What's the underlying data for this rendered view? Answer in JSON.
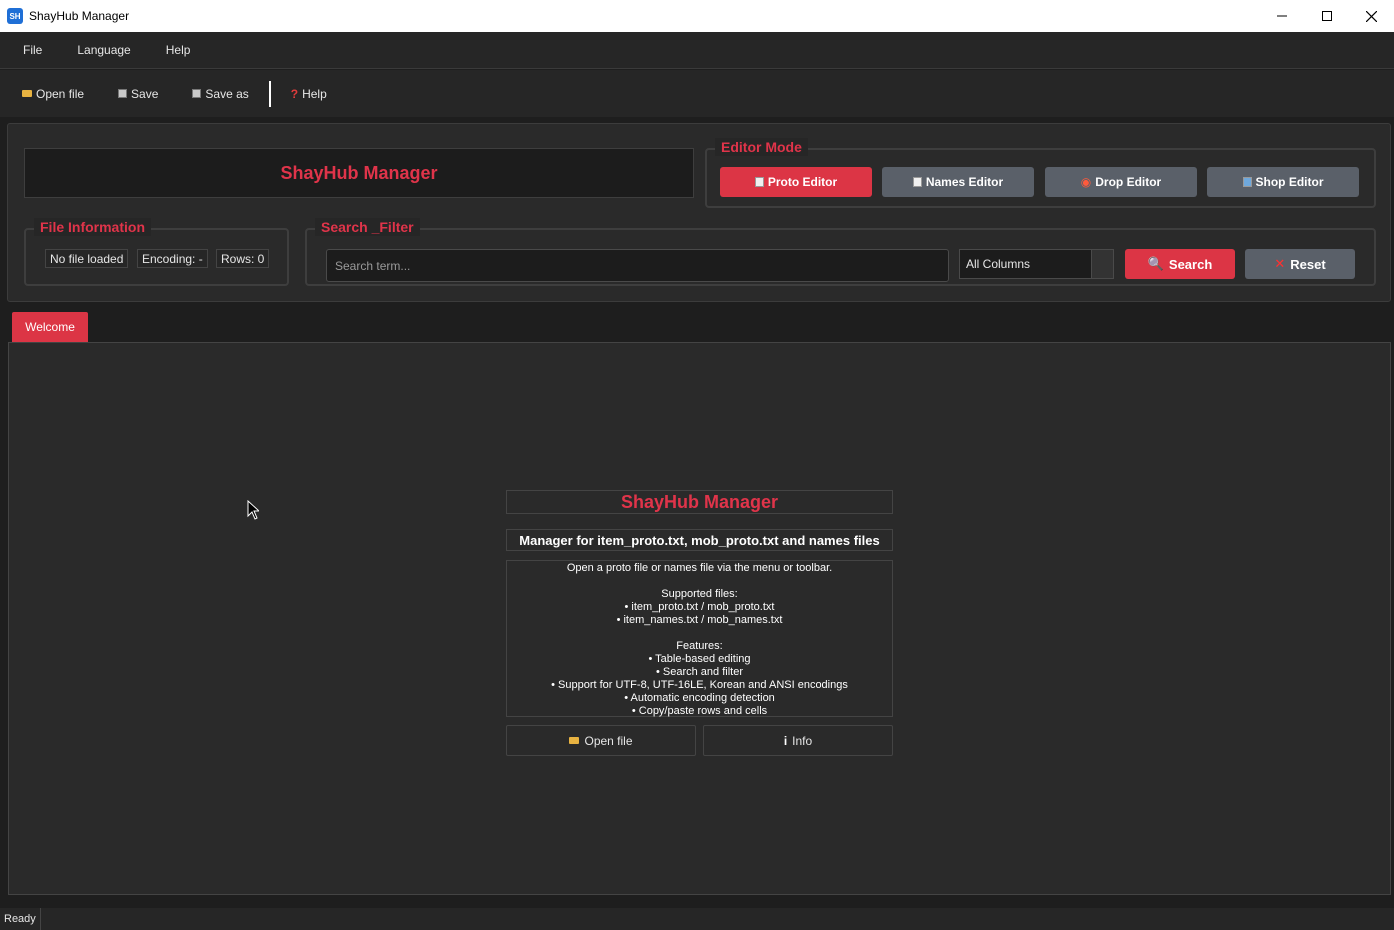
{
  "window": {
    "title": "ShayHub Manager",
    "icon_text": "SH"
  },
  "menu": {
    "items": [
      "File",
      "Language",
      "Help"
    ]
  },
  "toolbar": {
    "open_label": "Open file",
    "save_label": "Save",
    "saveas_label": "Save as",
    "help_label": "Help"
  },
  "header": {
    "brand": "ShayHub Manager"
  },
  "editor_mode": {
    "legend": "Editor Mode",
    "buttons": [
      "Proto Editor",
      "Names Editor",
      "Drop Editor",
      "Shop Editor"
    ],
    "active": "Proto Editor"
  },
  "file_info": {
    "legend": "File Information",
    "file": "No file loaded",
    "encoding": "Encoding: -",
    "rows": "Rows: 0"
  },
  "search": {
    "legend": "Search _Filter",
    "placeholder": "Search term...",
    "column": "All Columns",
    "search_label": "Search",
    "reset_label": "Reset"
  },
  "tabs": [
    "Welcome"
  ],
  "welcome": {
    "title": "ShayHub Manager",
    "subtitle": "Manager for item_proto.txt, mob_proto.txt and names files",
    "intro": "Open a proto file or names file via the menu or toolbar.",
    "supported_heading": "Supported files:",
    "supported": [
      "• item_proto.txt / mob_proto.txt",
      "• item_names.txt / mob_names.txt"
    ],
    "features_heading": "Features:",
    "features": [
      "• Table-based editing",
      "• Search and filter",
      "• Support for UTF-8, UTF-16LE, Korean and ANSI encodings",
      "• Automatic encoding detection",
      "• Copy/paste rows and cells"
    ],
    "open_label": "Open file",
    "info_label": "Info"
  },
  "status": {
    "text": "Ready"
  },
  "colors": {
    "accent": "#dc3545",
    "neutral_button": "#5a6069",
    "background": "#1e1e1e"
  }
}
